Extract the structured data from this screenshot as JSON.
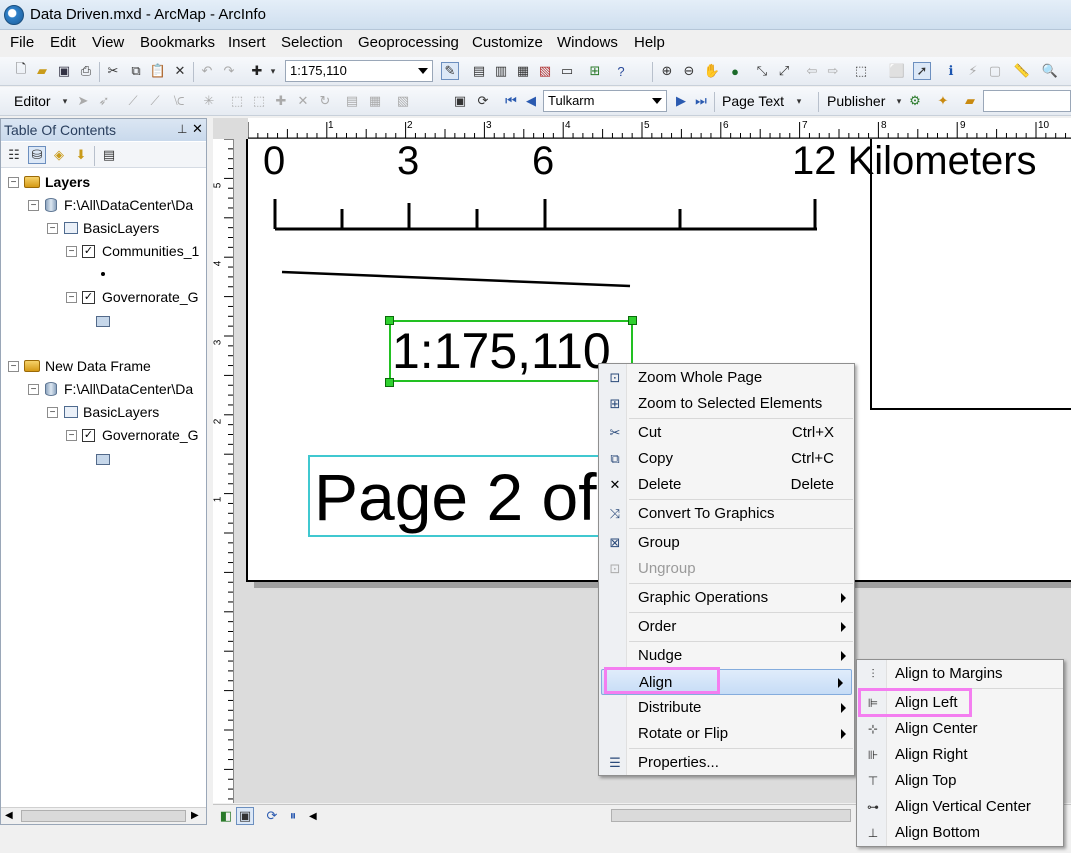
{
  "window": {
    "title": "Data Driven.mxd - ArcMap - ArcInfo"
  },
  "menubar": [
    "File",
    "Edit",
    "View",
    "Bookmarks",
    "Insert",
    "Selection",
    "Geoprocessing",
    "Customize",
    "Windows",
    "Help"
  ],
  "toolbar1": {
    "scale_value": "1:175,110"
  },
  "toolbar2": {
    "editor_label": "Editor",
    "page_value": "Tulkarm",
    "page_text_label": "Page Text",
    "publisher_label": "Publisher"
  },
  "toc": {
    "title": "Table Of Contents",
    "items": [
      {
        "label": "Layers",
        "bold": true
      },
      {
        "label": "F:\\All\\DataCenter\\Da"
      },
      {
        "label": "BasicLayers"
      },
      {
        "label": "Communities_1"
      },
      {
        "label": "Governorate_G"
      },
      {
        "label": "New Data Frame"
      },
      {
        "label": "F:\\All\\DataCenter\\Da"
      },
      {
        "label": "BasicLayers"
      },
      {
        "label": "Governorate_G"
      }
    ]
  },
  "rulers": {
    "h_ticks": [
      "1",
      "2",
      "3",
      "4",
      "5",
      "6",
      "7",
      "8",
      "9",
      "10"
    ],
    "v_ticks": [
      "5",
      "4",
      "3",
      "2",
      "1"
    ]
  },
  "layout": {
    "scalebar_labels": [
      "0",
      "3",
      "6",
      "12 Kilometers"
    ],
    "scale_text": "1:175,110",
    "page_text": "Page 2 of"
  },
  "context_menu": {
    "items": [
      {
        "label": "Zoom Whole Page",
        "icon": "zoom-page-icon"
      },
      {
        "label": "Zoom to Selected Elements",
        "icon": "zoom-selected-icon"
      },
      {
        "label": "Cut",
        "shortcut": "Ctrl+X",
        "icon": "scissors-icon"
      },
      {
        "label": "Copy",
        "shortcut": "Ctrl+C",
        "icon": "copy-icon"
      },
      {
        "label": "Delete",
        "shortcut": "Delete",
        "icon": "delete-icon"
      },
      {
        "label": "Convert To Graphics",
        "icon": "convert-icon"
      },
      {
        "label": "Group",
        "icon": "group-icon"
      },
      {
        "label": "Ungroup",
        "icon": "ungroup-icon",
        "disabled": true
      },
      {
        "label": "Graphic Operations",
        "submenu": true
      },
      {
        "label": "Order",
        "submenu": true
      },
      {
        "label": "Nudge",
        "submenu": true
      },
      {
        "label": "Align",
        "submenu": true,
        "highlighted": true
      },
      {
        "label": "Distribute",
        "submenu": true
      },
      {
        "label": "Rotate or Flip",
        "submenu": true
      },
      {
        "label": "Properties...",
        "icon": "properties-icon"
      }
    ]
  },
  "align_submenu": {
    "items": [
      {
        "label": "Align to Margins"
      },
      {
        "label": "Align Left"
      },
      {
        "label": "Align Center"
      },
      {
        "label": "Align Right"
      },
      {
        "label": "Align Top"
      },
      {
        "label": "Align Vertical Center"
      },
      {
        "label": "Align Bottom"
      }
    ]
  },
  "colors": {
    "selection": "#22c022",
    "highlight_marker": "#f47ef0",
    "text_box": "#40c8d0"
  }
}
